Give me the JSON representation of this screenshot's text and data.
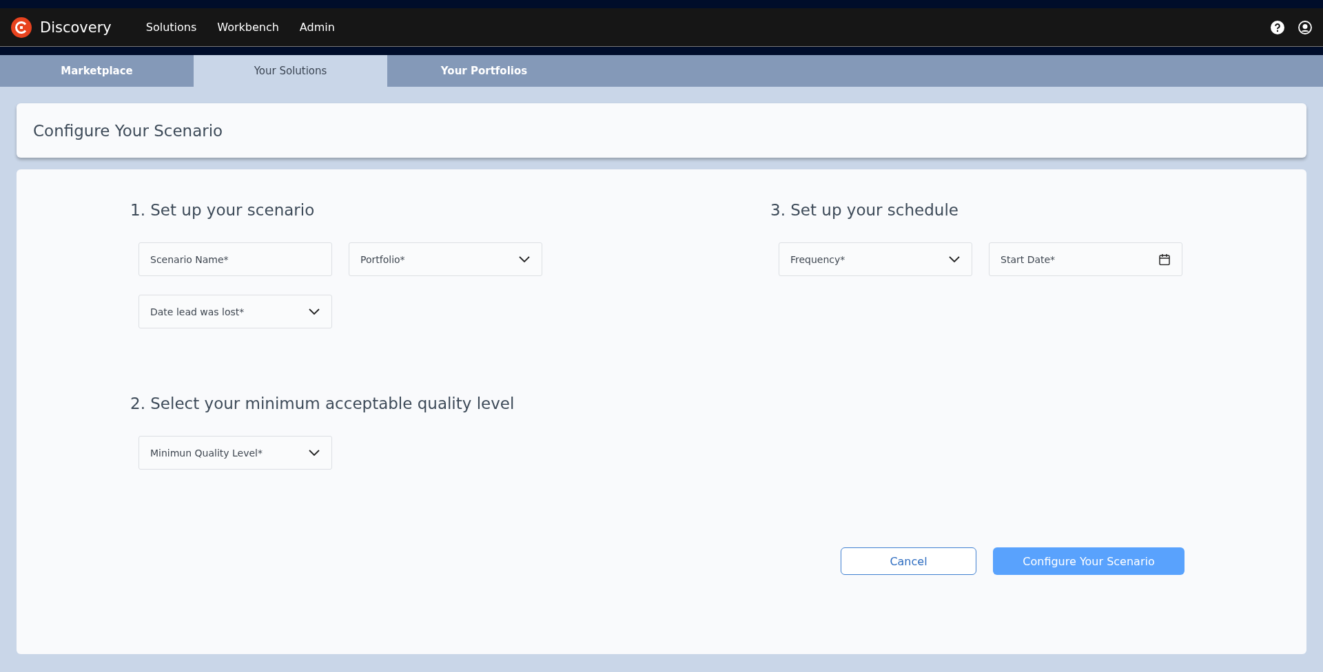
{
  "header": {
    "app_name": "Discovery",
    "nav": [
      {
        "label": "Solutions"
      },
      {
        "label": "Workbench"
      },
      {
        "label": "Admin"
      }
    ]
  },
  "tabs": [
    {
      "label": "Marketplace",
      "selected": false
    },
    {
      "label": "Your Solutions",
      "selected": true
    },
    {
      "label": "Your Portfolios",
      "selected": false
    }
  ],
  "page_title": "Configure Your Scenario",
  "left_column": {
    "sections": [
      {
        "heading": "1. Set up your scenario",
        "fields": [
          {
            "kind": "text",
            "placeholder": "Scenario Name*"
          },
          {
            "kind": "select",
            "placeholder": "Portfolio*"
          },
          {
            "kind": "select",
            "placeholder": "Date lead was lost*"
          }
        ]
      },
      {
        "heading": "2. Select your minimum acceptable quality level",
        "fields": [
          {
            "kind": "select",
            "placeholder": "Minimun Quality Level*"
          }
        ]
      }
    ]
  },
  "right_column": {
    "sections": [
      {
        "heading": "3. Set up your schedule",
        "fields": [
          {
            "kind": "select",
            "placeholder": "Frequency*"
          },
          {
            "kind": "date",
            "placeholder": "Start Date*"
          }
        ]
      }
    ]
  },
  "buttons": [
    {
      "label": "Cancel",
      "kind": "secondary"
    },
    {
      "label": "Configure Your Scenario",
      "kind": "primary"
    }
  ]
}
